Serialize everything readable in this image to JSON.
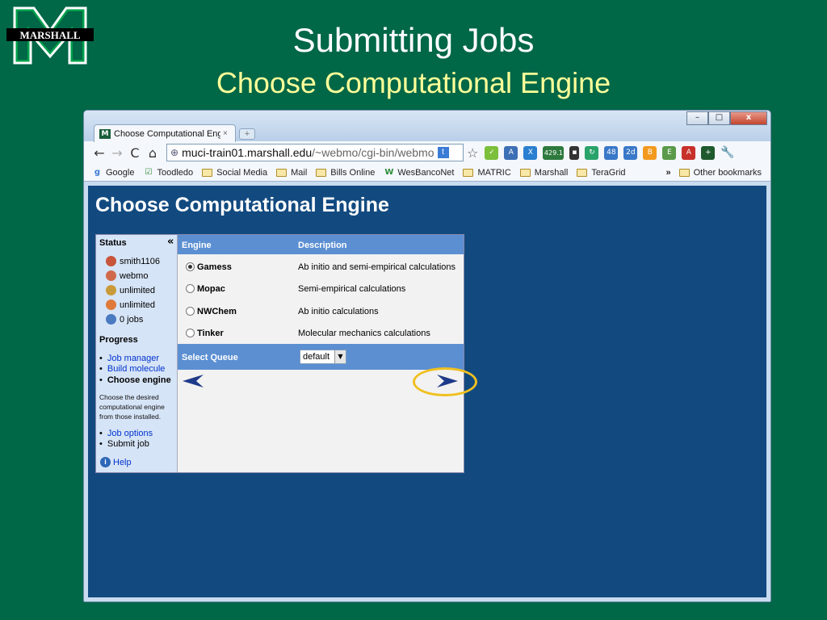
{
  "slide": {
    "title": "Submitting Jobs",
    "subtitle": "Choose Computational Engine",
    "logo_text": "MARSHALL",
    "colors": {
      "background": "#006747",
      "subtitle": "#ffff99",
      "highlight": "#f0c020"
    }
  },
  "browser": {
    "tab_title": "Choose Computational Eng",
    "tab_close": "×",
    "new_tab": "+",
    "window_controls": {
      "minimize": "–",
      "maximize": "□",
      "close": "x"
    },
    "nav": {
      "back": "←",
      "forward": "→",
      "reload": "C",
      "home": "⌂"
    },
    "url_host": "muci-train01.marshall.edu",
    "url_path": "/~webmo/cgi-bin/webmo",
    "ext_badges": {
      "count": "429.1",
      "a": "48",
      "b": "2d"
    },
    "bookmarks": [
      "Google",
      "Toodledo",
      "Social Media",
      "Mail",
      "Bills Online",
      "WesBancoNet",
      "MATRIC",
      "Marshall",
      "TeraGrid"
    ],
    "bookmarks_more": "»",
    "other_bookmarks": "Other bookmarks"
  },
  "page": {
    "heading": "Choose Computational Engine",
    "sidebar": {
      "status_title": "Status",
      "collapse": "«",
      "status": [
        {
          "icon": "user-icon",
          "text": "smith1106"
        },
        {
          "icon": "group-icon",
          "text": "webmo"
        },
        {
          "icon": "time-icon",
          "text": "unlimited"
        },
        {
          "icon": "clock-icon",
          "text": "unlimited"
        },
        {
          "icon": "jobs-icon",
          "text": "0 jobs"
        }
      ],
      "progress_title": "Progress",
      "progress": [
        {
          "text": "Job manager",
          "state": "link"
        },
        {
          "text": "Build molecule",
          "state": "link"
        },
        {
          "text": "Choose engine",
          "state": "current"
        },
        {
          "text": "Job options",
          "state": "link"
        },
        {
          "text": "Submit job",
          "state": "pending"
        }
      ],
      "note": "Choose the desired computational engine from those installed.",
      "help": "Help"
    },
    "table": {
      "col_engine": "Engine",
      "col_description": "Description",
      "engines": [
        {
          "name": "Gamess",
          "description": "Ab initio and semi-empirical calculations",
          "selected": true
        },
        {
          "name": "Mopac",
          "description": "Semi-empirical calculations",
          "selected": false
        },
        {
          "name": "NWChem",
          "description": "Ab initio calculations",
          "selected": false
        },
        {
          "name": "Tinker",
          "description": "Molecular mechanics calculations",
          "selected": false
        }
      ],
      "queue_label": "Select Queue",
      "queue_value": "default"
    }
  }
}
